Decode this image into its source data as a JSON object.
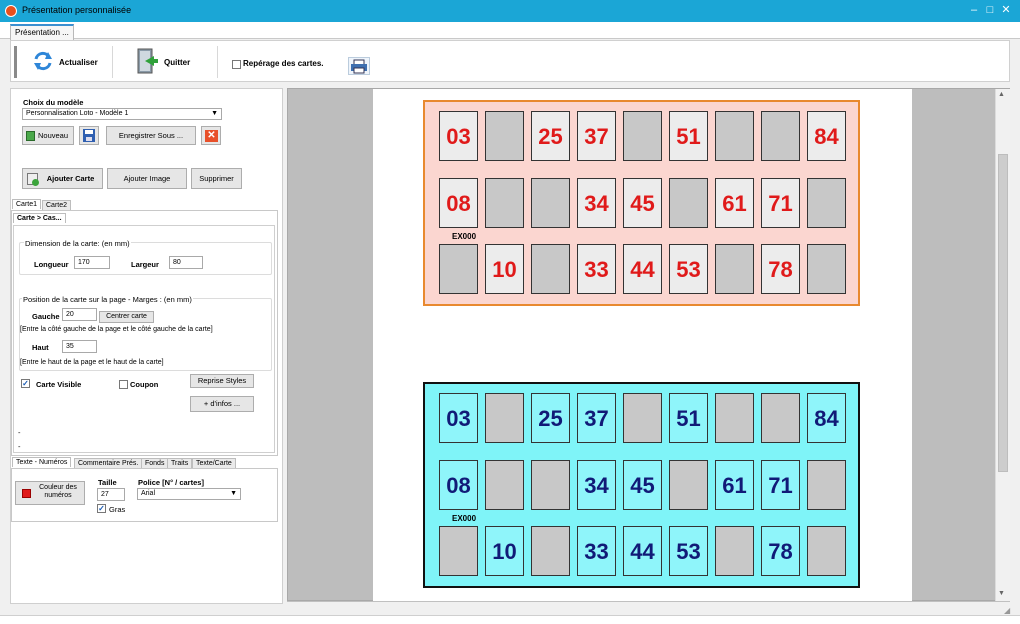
{
  "window": {
    "title": "Présentation personnalisée",
    "controls": [
      "–",
      "□",
      "✕"
    ]
  },
  "tabs": [
    "Présentation ..."
  ],
  "toolbar": {
    "refresh_label": "Actualiser",
    "quit_label": "Quitter",
    "marking_label": "Repérage des cartes.",
    "marking_checked": false
  },
  "model": {
    "section_label": "Choix du modèle",
    "selected": "Personnalisation Loto - Modèle 1",
    "new_label": "Nouveau",
    "save_as_label": "Enregistrer Sous ..."
  },
  "card_actions": {
    "add_card": "Ajouter Carte",
    "add_image": "Ajouter Image",
    "delete": "Supprimer"
  },
  "card_tabs": [
    "Carte1",
    "Carte2"
  ],
  "sub_tab": "Carte > Cas...",
  "dimension": {
    "label": "Dimension de la carte: (en mm)",
    "length_label": "Longueur",
    "length_value": "170",
    "width_label": "Largeur",
    "width_value": "80"
  },
  "position": {
    "label": "Position de la carte sur la page - Marges : (en mm)",
    "left_label": "Gauche",
    "left_value": "20",
    "center_label": "Centrer carte",
    "left_hint": "[Entre la côté gauche de la page et le côté gauche de la carte]",
    "top_label": "Haut",
    "top_value": "35",
    "top_hint": "[Entre le haut de la page et le haut de la carte]"
  },
  "options": {
    "visible_label": "Carte Visible",
    "visible_checked": true,
    "coupon_label": "Coupon",
    "coupon_checked": false,
    "styles_label": "Reprise Styles",
    "infos_label": "+ d'infos ..."
  },
  "dashes": [
    "-",
    "-"
  ],
  "text_tabs": [
    "Texte - Numéros",
    "Commentaire Prés.",
    "Fonds",
    "Traits",
    "Texte/Carte"
  ],
  "text_settings": {
    "color_label": "Couleur des numéros",
    "color": "#e01a1a",
    "size_label": "Taille",
    "size_value": "27",
    "bold_label": "Gras",
    "bold_checked": true,
    "font_label": "Police [N° / cartes]",
    "font_value": "Arial"
  },
  "cards": [
    {
      "code": "EX000",
      "rows": [
        [
          "03",
          "",
          "25",
          "37",
          "",
          "51",
          "",
          "",
          "84"
        ],
        [
          "08",
          "",
          "",
          "34",
          "45",
          "",
          "61",
          "71",
          ""
        ],
        [
          "",
          "10",
          "",
          "33",
          "44",
          "53",
          "",
          "78",
          ""
        ]
      ]
    },
    {
      "code": "EX000",
      "rows": [
        [
          "03",
          "",
          "25",
          "37",
          "",
          "51",
          "",
          "",
          "84"
        ],
        [
          "08",
          "",
          "",
          "34",
          "45",
          "",
          "61",
          "71",
          ""
        ],
        [
          "",
          "10",
          "",
          "33",
          "44",
          "53",
          "",
          "78",
          ""
        ]
      ]
    }
  ],
  "colors": {
    "titlebar": "#1ba6d6",
    "card1_bg": "#fbd6d0",
    "card1_border": "#e8892f",
    "card1_number": "#e01a1a",
    "card2_bg": "#7ff4f8",
    "card2_number": "#111a77"
  }
}
